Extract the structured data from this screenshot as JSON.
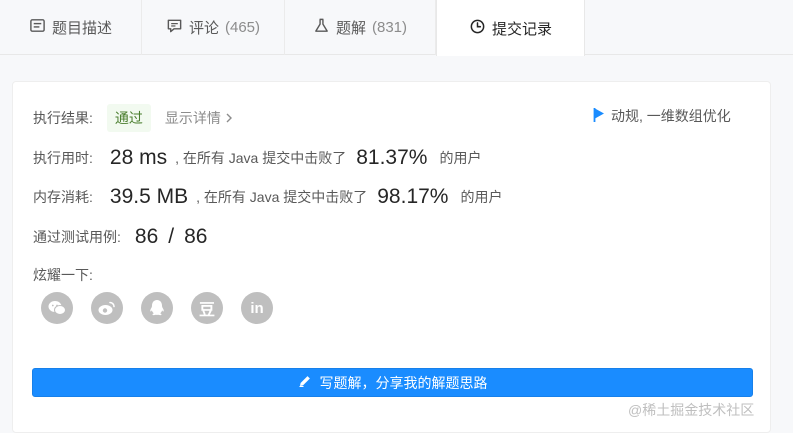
{
  "tabs": [
    {
      "label": "题目描述",
      "count": ""
    },
    {
      "label": "评论",
      "count": "(465)"
    },
    {
      "label": "题解",
      "count": "(831)"
    },
    {
      "label": "提交记录",
      "count": ""
    }
  ],
  "result": {
    "label": "执行结果:",
    "status": "通过",
    "detail_link": "显示详情",
    "animation_link": "动规, 一维数组优化"
  },
  "runtime": {
    "label": "执行用时:",
    "value": "28 ms",
    "text": ", 在所有 Java 提交中击败了",
    "percent": "81.37%",
    "suffix": "的用户"
  },
  "memory": {
    "label": "内存消耗:",
    "value": "39.5 MB",
    "text": ", 在所有 Java 提交中击败了",
    "percent": "98.17%",
    "suffix": "的用户"
  },
  "testcases": {
    "label": "通过测试用例:",
    "passed": "86",
    "separator": "/",
    "total": "86"
  },
  "share": {
    "label": "炫耀一下:",
    "icons": [
      "wechat-icon",
      "weibo-icon",
      "qq-icon",
      "douban-icon",
      "linkedin-icon"
    ],
    "douban_glyph": "豆",
    "linkedin_glyph": "in"
  },
  "write_button": "写题解，分享我的解题思路",
  "watermark": "@稀土掘金技术社区",
  "colors": {
    "accent": "#1a8cff",
    "pass_bg": "#f2faf0",
    "pass_text": "#4a7e2e"
  }
}
